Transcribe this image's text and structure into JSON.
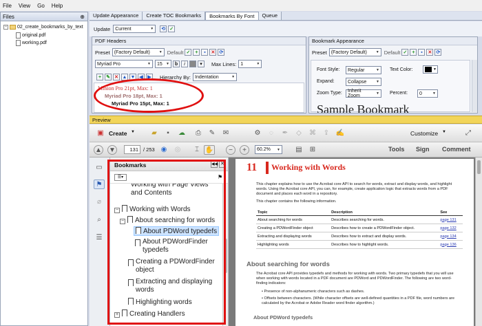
{
  "menu": [
    "File",
    "View",
    "Go",
    "Help"
  ],
  "files": {
    "title": "Files",
    "pin": "⊕",
    "folder": "02_create_bookmarks_by_text",
    "items": [
      "original.pdf",
      "working.pdf"
    ]
  },
  "tabs": [
    "Update Appearance",
    "Create TOC Bookmarks",
    "Bookmarks By Font",
    "Queue"
  ],
  "update": {
    "label": "Update",
    "value": "Current"
  },
  "pdf_headers": {
    "title": "PDF Headers",
    "preset_label": "Preset",
    "preset_value": "(Factory Default)",
    "default_label": "Default",
    "font_value": "Myriad Pro",
    "size_value": "15",
    "max_lines_label": "Max Lines:",
    "max_lines_value": "1",
    "hierarchy_label": "Hierarchy By:",
    "hierarchy_value": "Indentation",
    "headers": [
      {
        "text": "Minion Pro 21pt, Max: 1",
        "color": "#c83232"
      },
      {
        "text": "Myriad Pro 18pt, Max: 1",
        "color": "#a07070"
      },
      {
        "text": "Myriad Pro 15pt, Max: 1",
        "color": "#111111"
      }
    ]
  },
  "bookmark_appearance": {
    "title": "Bookmark Appearance",
    "preset_label": "Preset",
    "preset_value": "(Factory Default)",
    "default_label": "Default",
    "font_style_label": "Font Style:",
    "font_style_value": "Regular",
    "text_color_label": "Text Color:",
    "expand_label": "Expand:",
    "expand_value": "Collapse",
    "zoom_label": "Zoom Type:",
    "zoom_value": "Inherit Zoom",
    "percent_label": "Percent:",
    "percent_value": "0",
    "sample_text": "Sample Bookmark"
  },
  "preview": {
    "title": "Preview"
  },
  "acrobat": {
    "create_label": "Create",
    "customize_label": "Customize",
    "page_current": "131",
    "page_total": "/ 253",
    "zoom": "60.2%",
    "tools_label": "Tools",
    "sign_label": "Sign",
    "comment_label": "Comment"
  },
  "bookmarks": {
    "title": "Bookmarks",
    "items": [
      "Working with Page Views and Contents",
      "Working with Words",
      "About searching for words",
      "About PDWord typedefs",
      "About PDWordFinder typedefs",
      "Creating a PDWordFinder object",
      "Extracting and displaying words",
      "Highlighting words",
      "Creating Handlers"
    ]
  },
  "doc": {
    "chapter_num": "11",
    "chapter_title": "Working with Words",
    "intro1": "This chapter explains how to use the Acrobat core API to search for words, extract and display words, and highlight words. Using the Acrobat core API, you can, for example, create application logic that extracts words from a PDF document and places each word in a repository.",
    "intro2": "This chapter contains the following information.",
    "table_headers": [
      "Topic",
      "Description",
      "See"
    ],
    "table_rows": [
      [
        "About searching for words",
        "Describes searching for words.",
        "page 131"
      ],
      [
        "Creating a PDWordFinder object",
        "Describes how to create a PDWordFinder object.",
        "page 132"
      ],
      [
        "Extracting and displaying words",
        "Describes how to extract and display words.",
        "page 134"
      ],
      [
        "Highlighting words",
        "Describes how to highlight words.",
        "page 136"
      ]
    ],
    "section_title": "About searching for words",
    "section_text": "The Acrobat core API provides typedefs and methods for working with words. Two primary typedefs that you will use when working with words located in a PDF document are PDWord and PDWordFinder. The following are two word-finding indicators:",
    "bullets": [
      "Presence of non-alphanumeric characters such as dashes.",
      "Offsets between characters. (While character offsets are well-defined quantities in a PDF file, word numbers are calculated by the Acrobat or Adobe Reader word finder algorithm.)"
    ],
    "subsection_title": "About PDWord typedefs"
  },
  "colors": {
    "accent_red": "#e01010",
    "preview_bar": "#f2d55a",
    "chapter_red": "#d8281e"
  }
}
